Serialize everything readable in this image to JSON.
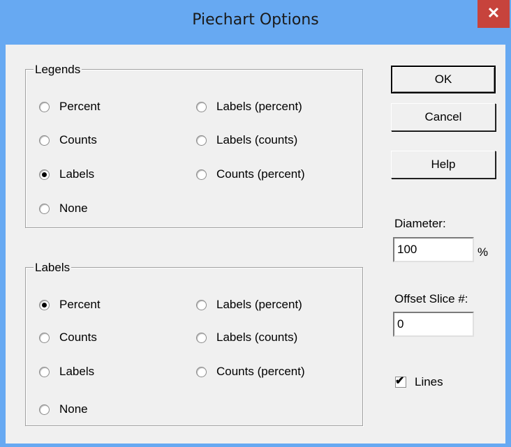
{
  "window": {
    "title": "Piechart Options",
    "close_symbol": "✕"
  },
  "legends": {
    "title": "Legends",
    "options": [
      {
        "label": "Percent",
        "checked": false
      },
      {
        "label": "Counts",
        "checked": false
      },
      {
        "label": "Labels",
        "checked": true
      },
      {
        "label": "None",
        "checked": false
      },
      {
        "label": "Labels (percent)",
        "checked": false
      },
      {
        "label": "Labels (counts)",
        "checked": false
      },
      {
        "label": "Counts (percent)",
        "checked": false
      }
    ]
  },
  "labels": {
    "title": "Labels",
    "options": [
      {
        "label": "Percent",
        "checked": true
      },
      {
        "label": "Counts",
        "checked": false
      },
      {
        "label": "Labels",
        "checked": false
      },
      {
        "label": "None",
        "checked": false
      },
      {
        "label": "Labels (percent)",
        "checked": false
      },
      {
        "label": "Labels (counts)",
        "checked": false
      },
      {
        "label": "Counts (percent)",
        "checked": false
      }
    ]
  },
  "buttons": {
    "ok": "OK",
    "cancel": "Cancel",
    "help": "Help"
  },
  "diameter": {
    "label": "Diameter:",
    "value": "100",
    "unit": "%"
  },
  "offset_slice": {
    "label": "Offset Slice #:",
    "value": "0"
  },
  "lines": {
    "label": "Lines",
    "checked": true,
    "check_symbol": "✔"
  }
}
